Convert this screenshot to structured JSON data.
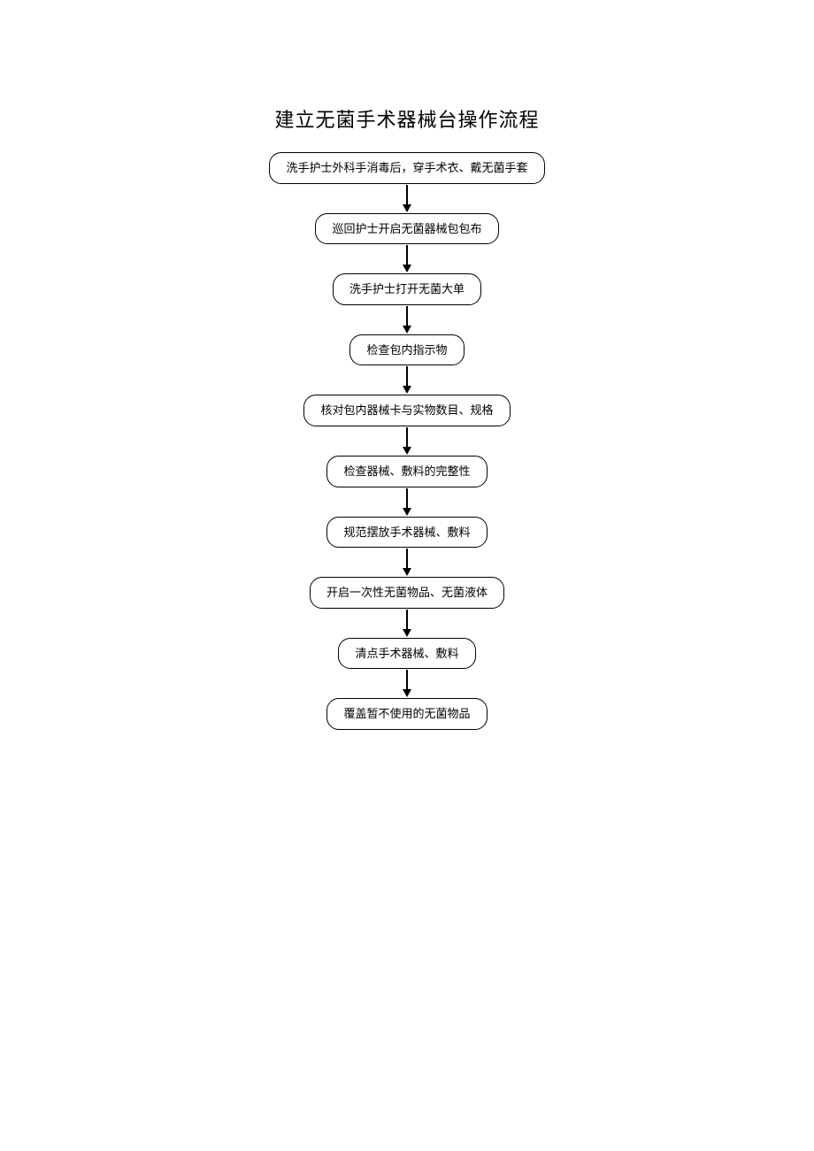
{
  "title": "建立无菌手术器械台操作流程",
  "chart_data": {
    "type": "flowchart",
    "direction": "vertical",
    "nodes": [
      "洗手护士外科手消毒后，穿手术衣、戴无菌手套",
      "巡回护士开启无菌器械包包布",
      "洗手护士打开无菌大单",
      "检查包内指示物",
      "核对包内器械卡与实物数目、规格",
      "检查器械、敷料的完整性",
      "规范摆放手术器械、敷料",
      "开启一次性无菌物品、无菌液体",
      "清点手术器械、敷料",
      "覆盖暂不使用的无菌物品"
    ]
  }
}
